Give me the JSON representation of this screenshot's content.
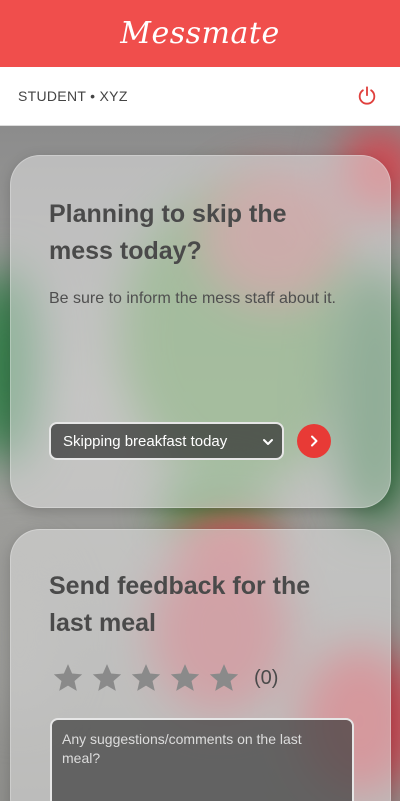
{
  "header": {
    "title": "Messmate"
  },
  "user_bar": {
    "user_label": "STUDENT • XYZ",
    "logout_icon": "power-icon"
  },
  "skip_card": {
    "title": "Planning to skip the mess today?",
    "subtitle": "Be sure to inform the mess staff about it.",
    "select_value": "Skipping breakfast today",
    "submit_icon": "chevron-right-icon"
  },
  "feedback_card": {
    "title": "Send feedback for the last meal",
    "rating": 0,
    "rating_max": 5,
    "rating_count": "(0)",
    "comment_placeholder": "Any suggestions/comments on the last meal?"
  },
  "colors": {
    "brand": "#f04e4c",
    "button": "#e83a36",
    "star": "#8a8a8a"
  }
}
